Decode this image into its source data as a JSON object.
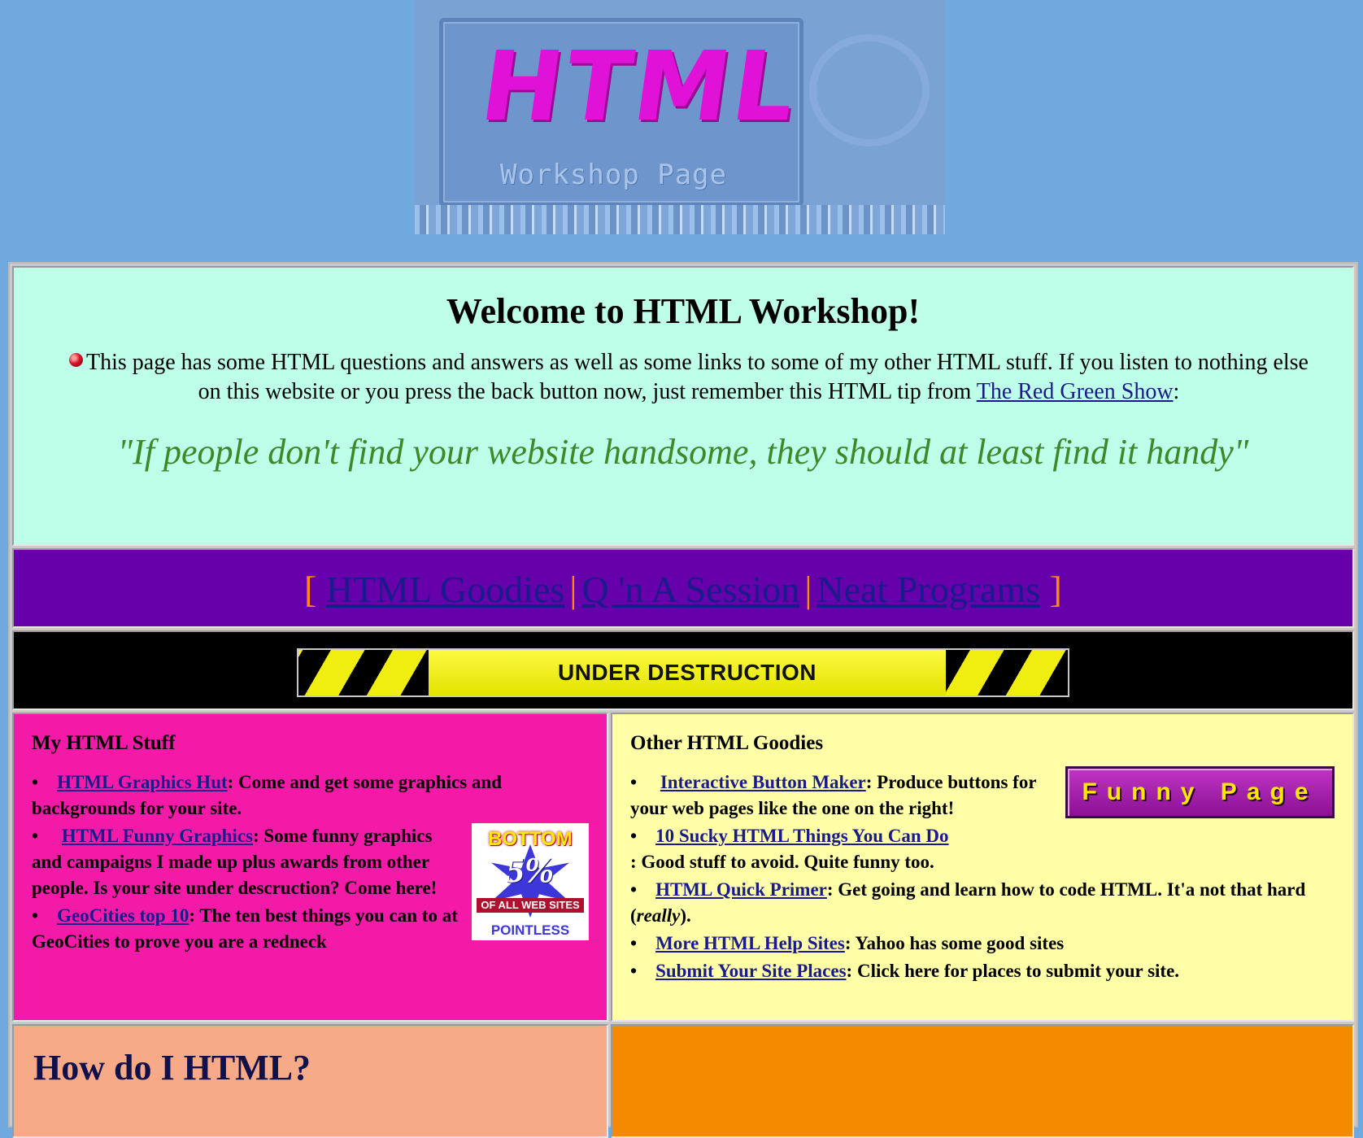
{
  "banner": {
    "title": "HTML",
    "subtitle": "Workshop Page"
  },
  "welcome": {
    "heading": "Welcome to HTML Workshop!",
    "intro_before_link": "This page has some HTML questions and answers as well as some links to some of my other HTML stuff. If you listen to nothing else on this website or you press the back button now, just remember this HTML tip from ",
    "intro_link": "The Red Green Show",
    "intro_after_link": ":",
    "quote": "\"If people don't find your website handsome, they should at least find it handy\""
  },
  "nav": {
    "open_bracket": "[",
    "close_bracket": "]",
    "separator": "|",
    "items": [
      "HTML Goodies",
      "Q 'n A Session",
      "Neat Programs"
    ]
  },
  "destruction_banner": {
    "text": "UNDER DESTRUCTION"
  },
  "my_stuff": {
    "heading": "My HTML Stuff",
    "items": [
      {
        "link": "HTML Graphics Hut",
        "desc": ": Come and get some graphics and backgrounds for your site."
      },
      {
        "link": "HTML Funny Graphics",
        "desc": ": Some funny graphics and campaigns I made up plus awards from other people. Is your site under descruction? Come here!"
      },
      {
        "link": "GeoCities top 10",
        "desc": ": The ten best things you can to at GeoCities to prove you are a redneck"
      }
    ],
    "award": {
      "top": "BOTTOM",
      "number": "5%",
      "band": "OF ALL WEB SITES",
      "bottom": "POINTLESS"
    }
  },
  "other_goodies": {
    "heading": "Other HTML Goodies",
    "button_label": "Funny Page",
    "items": [
      {
        "link": "Interactive Button Maker",
        "desc": ": Produce buttons for your web pages like the one on the right!"
      },
      {
        "link": "10 Sucky HTML Things You Can Do",
        "desc": ": Good stuff to avoid. Quite funny too."
      },
      {
        "link": "HTML Quick Primer",
        "desc": ": Get going and learn how to code HTML. It'a not that hard (",
        "em": "really",
        "desc_end": ")."
      },
      {
        "link": "More HTML Help Sites",
        "desc": ": Yahoo has some good sites"
      },
      {
        "link": "Submit Your Site Places",
        "desc": ": Click here for places to submit your site."
      }
    ]
  },
  "howdo": {
    "heading": "How do I HTML?"
  },
  "colors": {
    "page_bg": "#6fa9dd",
    "welcome_bg": "#beffea",
    "nav_bg": "#6600aa",
    "stuff_bg": "#f31aa8",
    "goodies_bg": "#ffffa8",
    "howdo_bg": "#f7aa88",
    "orange_bg": "#f58a00",
    "quote_color": "#3a8a2a",
    "bracket_color": "#ff8a00"
  }
}
